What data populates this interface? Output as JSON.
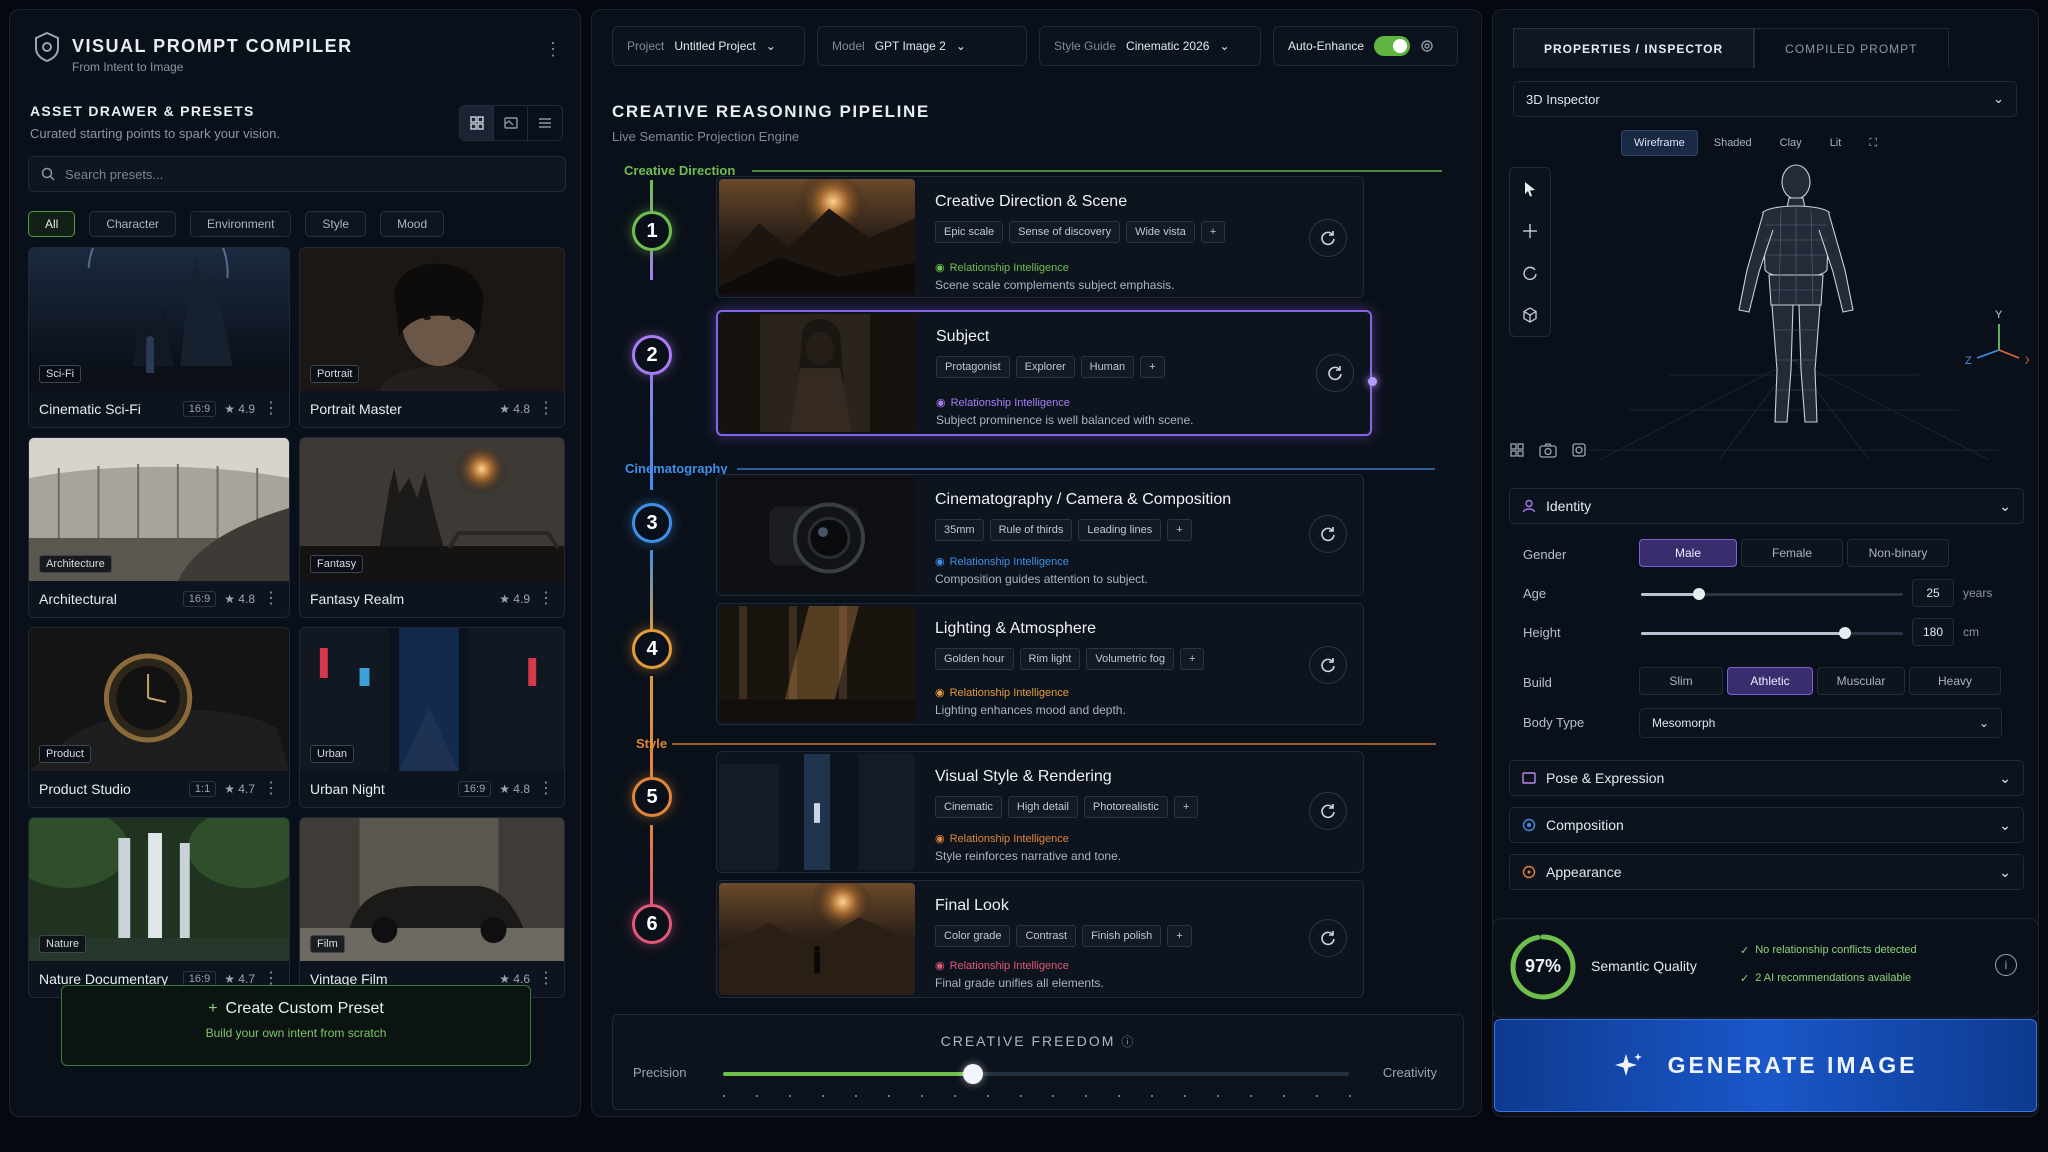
{
  "app": {
    "title": "VISUAL PROMPT COMPILER",
    "subtitle": "From Intent to Image"
  },
  "drawer": {
    "title": "ASSET DRAWER & PRESETS",
    "subtitle": "Curated starting points to spark your vision.",
    "search_placeholder": "Search presets...",
    "filters": [
      "All",
      "Character",
      "Environment",
      "Style",
      "Mood"
    ],
    "cards": [
      {
        "tag": "Sci-Fi",
        "name": "Cinematic Sci-Fi",
        "ratio": "16:9",
        "rating": "★ 4.9"
      },
      {
        "tag": "Portrait",
        "name": "Portrait Master",
        "ratio": "",
        "rating": "★ 4.8"
      },
      {
        "tag": "Architecture",
        "name": "Architectural",
        "ratio": "16:9",
        "rating": "★ 4.8"
      },
      {
        "tag": "Fantasy",
        "name": "Fantasy Realm",
        "ratio": "",
        "rating": "★ 4.9"
      },
      {
        "tag": "Product",
        "name": "Product Studio",
        "ratio": "1:1",
        "rating": "★ 4.7"
      },
      {
        "tag": "Urban",
        "name": "Urban Night",
        "ratio": "16:9",
        "rating": "★ 4.8"
      },
      {
        "tag": "Nature",
        "name": "Nature Documentary",
        "ratio": "16:9",
        "rating": "★ 4.7"
      },
      {
        "tag": "Film",
        "name": "Vintage Film",
        "ratio": "",
        "rating": "★ 4.6"
      }
    ],
    "create": {
      "label": "Create Custom Preset",
      "sub": "Build your own intent from scratch"
    }
  },
  "topbar": {
    "project_label": "Project",
    "project_value": "Untitled Project",
    "model_label": "Model",
    "model_value": "GPT Image 2",
    "style_label": "Style Guide",
    "style_value": "Cinematic 2026",
    "auto_label": "Auto-Enhance",
    "auto_on": true
  },
  "pipeline": {
    "title": "CREATIVE REASONING PIPELINE",
    "subtitle": "Live Semantic Projection Engine",
    "groups": [
      "Creative Direction",
      "Cinematography",
      "Style"
    ],
    "ri_label": "Relationship Intelligence",
    "stages": [
      {
        "num": "1",
        "title": "Creative Direction & Scene",
        "tags": [
          "Epic scale",
          "Sense of discovery",
          "Wide vista"
        ],
        "desc": "Scene scale complements subject emphasis.",
        "color": "#6fbf4e"
      },
      {
        "num": "2",
        "title": "Subject",
        "tags": [
          "Protagonist",
          "Explorer",
          "Human"
        ],
        "desc": "Subject prominence is well balanced with scene.",
        "color": "#a77cf2"
      },
      {
        "num": "3",
        "title": "Cinematography / Camera & Composition",
        "tags": [
          "35mm",
          "Rule of thirds",
          "Leading lines"
        ],
        "desc": "Composition guides attention to subject.",
        "color": "#3f8fe8"
      },
      {
        "num": "4",
        "title": "Lighting & Atmosphere",
        "tags": [
          "Golden hour",
          "Rim light",
          "Volumetric fog"
        ],
        "desc": "Lighting enhances mood and depth.",
        "color": "#e29a3a"
      },
      {
        "num": "5",
        "title": "Visual Style & Rendering",
        "tags": [
          "Cinematic",
          "High detail",
          "Photorealistic"
        ],
        "desc": "Style reinforces narrative and tone.",
        "color": "#e0843a"
      },
      {
        "num": "6",
        "title": "Final Look",
        "tags": [
          "Color grade",
          "Contrast",
          "Finish polish"
        ],
        "desc": "Final grade unifies all elements.",
        "color": "#e0577a"
      }
    ],
    "freedom": {
      "title": "CREATIVE FREEDOM",
      "left": "Precision",
      "right": "Creativity",
      "value": 0.4
    }
  },
  "inspector": {
    "tabs": [
      "PROPERTIES / INSPECTOR",
      "COMPILED PROMPT"
    ],
    "mode": "3D Inspector",
    "view_modes": [
      "Wireframe",
      "Shaded",
      "Clay",
      "Lit"
    ],
    "axes": {
      "y": "Y",
      "z": "Z",
      "x": "X"
    },
    "identity": {
      "title": "Identity",
      "gender_label": "Gender",
      "genders": [
        "Male",
        "Female",
        "Non-binary"
      ],
      "age_label": "Age",
      "age": "25",
      "age_unit": "years",
      "age_fill": 0.22,
      "height_label": "Height",
      "height": "180",
      "height_unit": "cm",
      "height_fill": 0.78,
      "build_label": "Build",
      "builds": [
        "Slim",
        "Athletic",
        "Muscular",
        "Heavy"
      ],
      "body_label": "Body Type",
      "body": "Mesomorph"
    },
    "sections": [
      "Pose & Expression",
      "Composition",
      "Appearance"
    ]
  },
  "quality": {
    "percent": "97%",
    "label": "Semantic Quality",
    "check1": "No relationship conflicts detected",
    "check2": "2 AI recommendations available"
  },
  "generate": {
    "label": "GENERATE IMAGE"
  },
  "colors": {
    "accent_green": "#6fbf4e",
    "accent_purple": "#8a62e6",
    "accent_blue": "#1a57c9"
  }
}
